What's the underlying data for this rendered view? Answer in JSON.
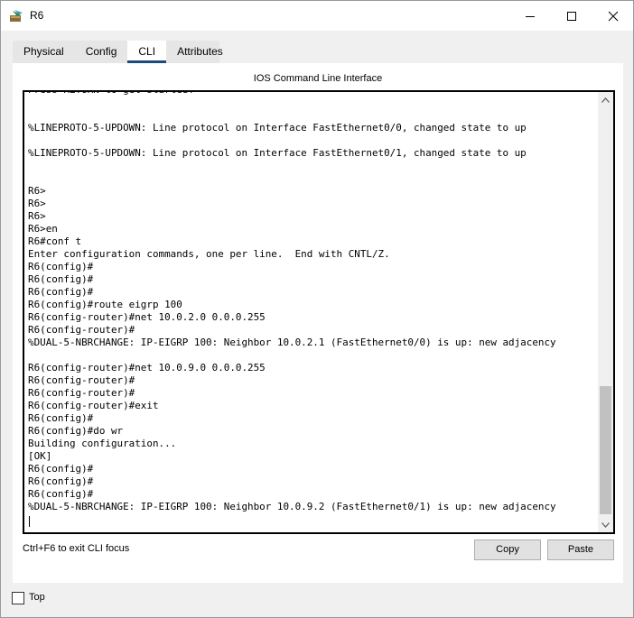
{
  "window": {
    "title": "R6",
    "controls": {
      "minimize": "minimize-icon",
      "maximize": "maximize-icon",
      "close": "close-icon"
    }
  },
  "tabs": [
    {
      "label": "Physical",
      "active": false
    },
    {
      "label": "Config",
      "active": false
    },
    {
      "label": "CLI",
      "active": true
    },
    {
      "label": "Attributes",
      "active": false
    }
  ],
  "panel": {
    "title": "IOS Command Line Interface",
    "console_text": "Press RETURN to get started!\n\n\n%LINEPROTO-5-UPDOWN: Line protocol on Interface FastEthernet0/0, changed state to up\n\n%LINEPROTO-5-UPDOWN: Line protocol on Interface FastEthernet0/1, changed state to up\n\n\nR6>\nR6>\nR6>\nR6>en\nR6#conf t\nEnter configuration commands, one per line.  End with CNTL/Z.\nR6(config)#\nR6(config)#\nR6(config)#\nR6(config)#route eigrp 100\nR6(config-router)#net 10.0.2.0 0.0.0.255\nR6(config-router)#\n%DUAL-5-NBRCHANGE: IP-EIGRP 100: Neighbor 10.0.2.1 (FastEthernet0/0) is up: new adjacency\n\nR6(config-router)#net 10.0.9.0 0.0.0.255\nR6(config-router)#\nR6(config-router)#\nR6(config-router)#exit\nR6(config)#\nR6(config)#do wr\nBuilding configuration...\n[OK]\nR6(config)#\nR6(config)#\nR6(config)#\n%DUAL-5-NBRCHANGE: IP-EIGRP 100: Neighbor 10.0.9.2 (FastEthernet0/1) is up: new adjacency"
  },
  "footer": {
    "hint": "Ctrl+F6 to exit CLI focus",
    "copy_label": "Copy",
    "paste_label": "Paste"
  },
  "bottom": {
    "top_label": "Top",
    "top_checked": false
  },
  "colors": {
    "active_tab_underline": "#1c4c7c",
    "background": "#f0f0f0",
    "panel": "#ffffff"
  }
}
